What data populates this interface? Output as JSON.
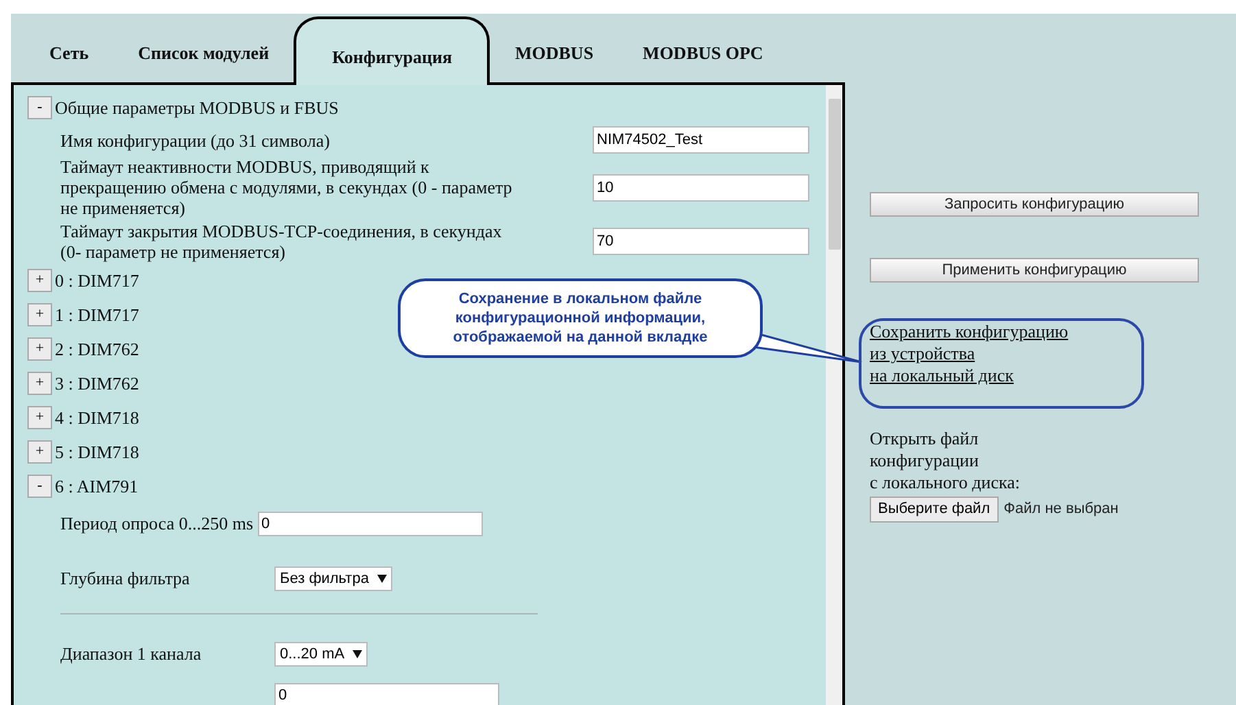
{
  "tabs": [
    {
      "label": "Сеть",
      "selected": false
    },
    {
      "label": "Список модулей",
      "selected": false
    },
    {
      "label": "Конфигурация",
      "selected": true
    },
    {
      "label": "MODBUS",
      "selected": false
    },
    {
      "label": "MODBUS OPC",
      "selected": false
    }
  ],
  "sections": [
    {
      "toggle": "-",
      "label": "Общие параметры MODBUS и FBUS",
      "fields": [
        {
          "kind": "wide",
          "label": "Имя конфигурации (до 31 символа)",
          "value": "NIM74502_Test"
        },
        {
          "kind": "wide",
          "label": "Таймаут неактивности MODBUS, приводящий к прекращению обмена с модулями, в секундах (0 - параметр не применяется)",
          "value": "10"
        },
        {
          "kind": "wide",
          "label": "Таймаут закрытия MODBUS-TCP-соединения, в секундах (0- параметр не применяется)",
          "value": "70"
        }
      ]
    },
    {
      "toggle": "+",
      "label": "0 : DIM717"
    },
    {
      "toggle": "+",
      "label": "1 : DIM717"
    },
    {
      "toggle": "+",
      "label": "2 : DIM762"
    },
    {
      "toggle": "+",
      "label": "3 : DIM762"
    },
    {
      "toggle": "+",
      "label": "4 : DIM718"
    },
    {
      "toggle": "+",
      "label": "5 : DIM718"
    },
    {
      "toggle": "-",
      "label": "6 : AIM791",
      "fields": [
        {
          "kind": "input",
          "label": "Период опроса 0...250 ms",
          "value": "0"
        },
        {
          "kind": "select",
          "label": "Глубина фильтра",
          "value": "Без фильтра"
        },
        {
          "kind": "divider"
        },
        {
          "kind": "select",
          "label": "Диапазон 1 канала",
          "value": "0...20 mA"
        },
        {
          "kind": "input",
          "value": "0"
        }
      ]
    }
  ],
  "callout": "Сохранение в локальном файле конфигурационной информации, отображаемой на данной вкладке",
  "actions": [
    "Запросить конфигурацию",
    "Применить конфигурацию"
  ],
  "save_link": [
    "Сохранить конфигурацию",
    "из устройства",
    "на локальный диск"
  ],
  "open_file": {
    "text": [
      "Открыть файл",
      "конфигурации",
      "с локального диска:"
    ],
    "button": "Выберите файл",
    "status": "Файл не выбран"
  }
}
